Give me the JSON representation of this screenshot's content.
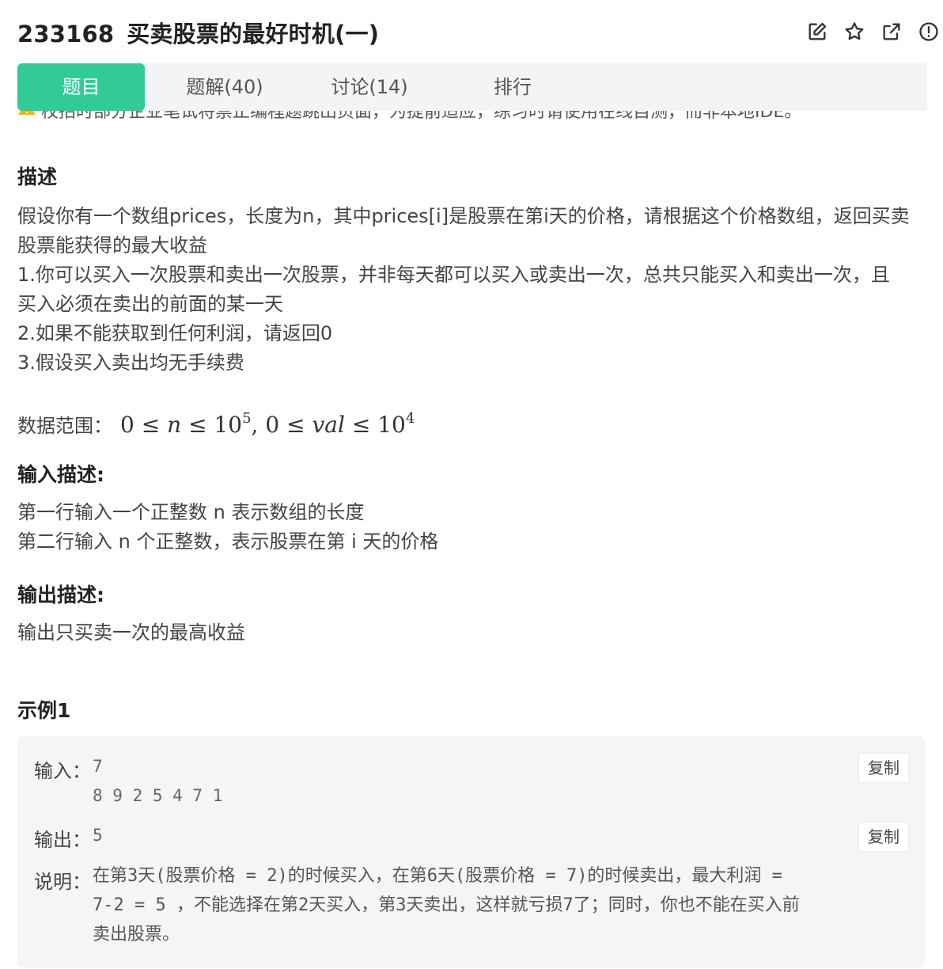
{
  "header": {
    "problem_id": "233168",
    "problem_title": "买卖股票的最好时机(一)"
  },
  "tabs": [
    {
      "label": "题目",
      "active": true
    },
    {
      "label": "题解(40)",
      "active": false
    },
    {
      "label": "讨论(14)",
      "active": false
    },
    {
      "label": "排行",
      "active": false
    }
  ],
  "notice": {
    "text": "校招时部分企业笔试将禁止编程题跳出页面，为提前适应，练习时请使用在线自测，而非本地IDE。"
  },
  "description": {
    "heading": "描述",
    "lines": [
      "假设你有一个数组prices，长度为n，其中prices[i]是股票在第i天的价格，请根据这个价格数组，返回买卖",
      "股票能获得的最大收益",
      "1.你可以买入一次股票和卖出一次股票，并非每天都可以买入或卖出一次，总共只能买入和卖出一次，且",
      "买入必须在卖出的前面的某一天",
      "2.如果不能获取到任何利润，请返回0",
      "3.假设买入卖出均无手续费"
    ],
    "range_label": "数据范围：",
    "range_math": {
      "a": "0",
      "le": "≤",
      "n": "n",
      "b": "10",
      "exp1": "5",
      "comma": ",",
      "val": "val",
      "exp2": "4"
    }
  },
  "input_desc": {
    "heading": "输入描述:",
    "lines": [
      "第一行输入一个正整数 n 表示数组的长度",
      "第二行输入 n 个正整数，表示股票在第 i 天的价格"
    ]
  },
  "output_desc": {
    "heading": "输出描述:",
    "lines": [
      "输出只买卖一次的最高收益"
    ]
  },
  "example": {
    "heading": "示例1",
    "input_label": "输入：",
    "input_lines": [
      "7",
      "8 9 2 5 4 7 1"
    ],
    "output_label": "输出：",
    "output_value": "5",
    "explain_label": "说明：",
    "explain_lines": [
      "在第3天(股票价格 = 2)的时候买入，在第6天(股票价格 = 7)的时候卖出，最大利润 =",
      "7-2 = 5 ，不能选择在第2天买入，第3天卖出，这样就亏损7了；同时，你也不能在买入前",
      "卖出股票。"
    ],
    "copy_label": "复制"
  },
  "icons": [
    "edit-icon",
    "star-icon",
    "share-icon",
    "report-icon",
    "warning-icon"
  ],
  "colors": {
    "accent": "#32ca99",
    "tab_bar_bg": "#f3f4f6",
    "example_bg": "#f4f5f6",
    "warning": "#f5b800"
  }
}
